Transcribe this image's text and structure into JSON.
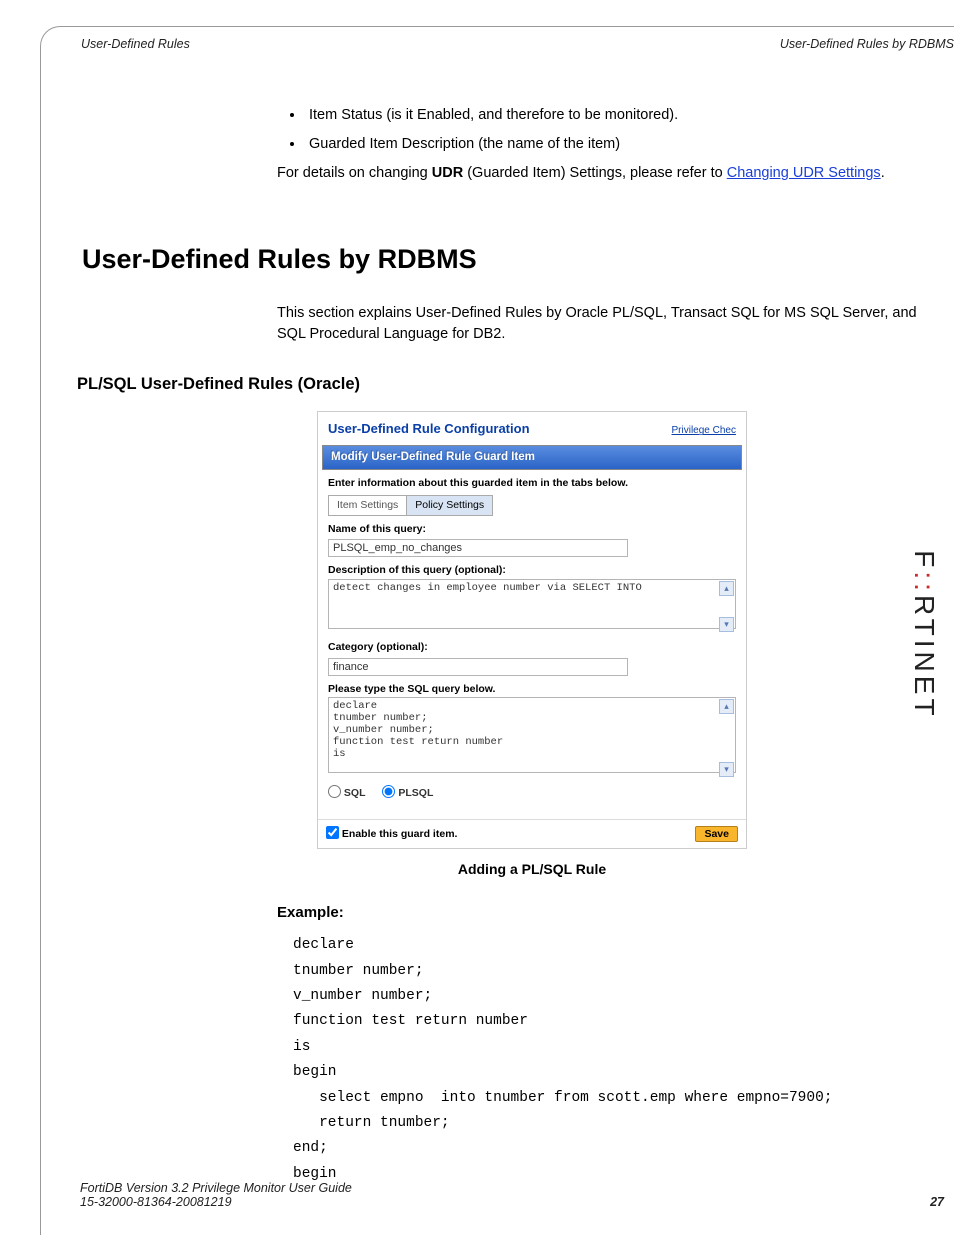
{
  "running_header": {
    "left": "User-Defined Rules",
    "right": "User-Defined Rules by RDBMS"
  },
  "bullets": [
    "Item Status (is it Enabled, and therefore to be monitored).",
    "Guarded Item Description (the name of the item)"
  ],
  "para_prefix": "For details on changing ",
  "para_bold": "UDR",
  "para_mid": " (Guarded Item) Settings, please refer to  ",
  "para_link": "Changing UDR Settings",
  "para_suffix": ".",
  "h1": "User-Defined Rules by RDBMS",
  "intro": "This section explains User-Defined Rules by Oracle PL/SQL, Transact SQL for MS SQL Server, and SQL Procedural Language for DB2.",
  "h2": "PL/SQL User-Defined Rules (Oracle)",
  "screenshot": {
    "title": "User-Defined Rule Configuration",
    "top_link": "Privilege Chec",
    "subbar": "Modify User-Defined Rule Guard Item",
    "hint": "Enter information about this guarded item in the tabs below.",
    "tab1": "Item Settings",
    "tab2": "Policy Settings",
    "lbl_name": "Name of this query:",
    "val_name": "PLSQL_emp_no_changes",
    "lbl_desc": "Description of this query (optional):",
    "val_desc": "detect changes in employee number via SELECT INTO",
    "lbl_cat": "Category (optional):",
    "val_cat": "finance",
    "lbl_sql": "Please type the SQL query below.",
    "val_sql": "declare\ntnumber number;\nv_number number;\nfunction test return number\nis",
    "radio_sql": "SQL",
    "radio_plsql": "PLSQL",
    "chk": "Enable this guard item.",
    "save": "Save"
  },
  "caption": "Adding a PL/SQL Rule",
  "example_h": "Example:",
  "code": "declare\ntnumber number;\nv_number number;\nfunction test return number\nis\nbegin\n   select empno  into tnumber from scott.emp where empno=7900;\n   return tnumber;\nend;\nbegin",
  "footer": {
    "l1": "FortiDB Version 3.2 Privilege Monitor  User Guide",
    "l2": "15-32000-81364-20081219",
    "page": "27"
  },
  "brand_pre": "F",
  "brand_red": "::",
  "brand_post": "RTINET"
}
